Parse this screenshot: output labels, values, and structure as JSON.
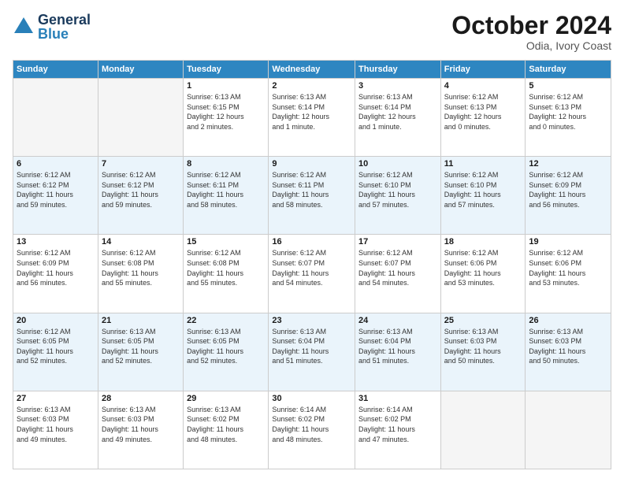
{
  "header": {
    "logo": {
      "line1": "General",
      "line2": "Blue"
    },
    "title": "October 2024",
    "subtitle": "Odia, Ivory Coast"
  },
  "days_of_week": [
    "Sunday",
    "Monday",
    "Tuesday",
    "Wednesday",
    "Thursday",
    "Friday",
    "Saturday"
  ],
  "weeks": [
    [
      {
        "day": "",
        "info": ""
      },
      {
        "day": "",
        "info": ""
      },
      {
        "day": "1",
        "info": "Sunrise: 6:13 AM\nSunset: 6:15 PM\nDaylight: 12 hours\nand 2 minutes."
      },
      {
        "day": "2",
        "info": "Sunrise: 6:13 AM\nSunset: 6:14 PM\nDaylight: 12 hours\nand 1 minute."
      },
      {
        "day": "3",
        "info": "Sunrise: 6:13 AM\nSunset: 6:14 PM\nDaylight: 12 hours\nand 1 minute."
      },
      {
        "day": "4",
        "info": "Sunrise: 6:12 AM\nSunset: 6:13 PM\nDaylight: 12 hours\nand 0 minutes."
      },
      {
        "day": "5",
        "info": "Sunrise: 6:12 AM\nSunset: 6:13 PM\nDaylight: 12 hours\nand 0 minutes."
      }
    ],
    [
      {
        "day": "6",
        "info": "Sunrise: 6:12 AM\nSunset: 6:12 PM\nDaylight: 11 hours\nand 59 minutes."
      },
      {
        "day": "7",
        "info": "Sunrise: 6:12 AM\nSunset: 6:12 PM\nDaylight: 11 hours\nand 59 minutes."
      },
      {
        "day": "8",
        "info": "Sunrise: 6:12 AM\nSunset: 6:11 PM\nDaylight: 11 hours\nand 58 minutes."
      },
      {
        "day": "9",
        "info": "Sunrise: 6:12 AM\nSunset: 6:11 PM\nDaylight: 11 hours\nand 58 minutes."
      },
      {
        "day": "10",
        "info": "Sunrise: 6:12 AM\nSunset: 6:10 PM\nDaylight: 11 hours\nand 57 minutes."
      },
      {
        "day": "11",
        "info": "Sunrise: 6:12 AM\nSunset: 6:10 PM\nDaylight: 11 hours\nand 57 minutes."
      },
      {
        "day": "12",
        "info": "Sunrise: 6:12 AM\nSunset: 6:09 PM\nDaylight: 11 hours\nand 56 minutes."
      }
    ],
    [
      {
        "day": "13",
        "info": "Sunrise: 6:12 AM\nSunset: 6:09 PM\nDaylight: 11 hours\nand 56 minutes."
      },
      {
        "day": "14",
        "info": "Sunrise: 6:12 AM\nSunset: 6:08 PM\nDaylight: 11 hours\nand 55 minutes."
      },
      {
        "day": "15",
        "info": "Sunrise: 6:12 AM\nSunset: 6:08 PM\nDaylight: 11 hours\nand 55 minutes."
      },
      {
        "day": "16",
        "info": "Sunrise: 6:12 AM\nSunset: 6:07 PM\nDaylight: 11 hours\nand 54 minutes."
      },
      {
        "day": "17",
        "info": "Sunrise: 6:12 AM\nSunset: 6:07 PM\nDaylight: 11 hours\nand 54 minutes."
      },
      {
        "day": "18",
        "info": "Sunrise: 6:12 AM\nSunset: 6:06 PM\nDaylight: 11 hours\nand 53 minutes."
      },
      {
        "day": "19",
        "info": "Sunrise: 6:12 AM\nSunset: 6:06 PM\nDaylight: 11 hours\nand 53 minutes."
      }
    ],
    [
      {
        "day": "20",
        "info": "Sunrise: 6:12 AM\nSunset: 6:05 PM\nDaylight: 11 hours\nand 52 minutes."
      },
      {
        "day": "21",
        "info": "Sunrise: 6:13 AM\nSunset: 6:05 PM\nDaylight: 11 hours\nand 52 minutes."
      },
      {
        "day": "22",
        "info": "Sunrise: 6:13 AM\nSunset: 6:05 PM\nDaylight: 11 hours\nand 52 minutes."
      },
      {
        "day": "23",
        "info": "Sunrise: 6:13 AM\nSunset: 6:04 PM\nDaylight: 11 hours\nand 51 minutes."
      },
      {
        "day": "24",
        "info": "Sunrise: 6:13 AM\nSunset: 6:04 PM\nDaylight: 11 hours\nand 51 minutes."
      },
      {
        "day": "25",
        "info": "Sunrise: 6:13 AM\nSunset: 6:03 PM\nDaylight: 11 hours\nand 50 minutes."
      },
      {
        "day": "26",
        "info": "Sunrise: 6:13 AM\nSunset: 6:03 PM\nDaylight: 11 hours\nand 50 minutes."
      }
    ],
    [
      {
        "day": "27",
        "info": "Sunrise: 6:13 AM\nSunset: 6:03 PM\nDaylight: 11 hours\nand 49 minutes."
      },
      {
        "day": "28",
        "info": "Sunrise: 6:13 AM\nSunset: 6:03 PM\nDaylight: 11 hours\nand 49 minutes."
      },
      {
        "day": "29",
        "info": "Sunrise: 6:13 AM\nSunset: 6:02 PM\nDaylight: 11 hours\nand 48 minutes."
      },
      {
        "day": "30",
        "info": "Sunrise: 6:14 AM\nSunset: 6:02 PM\nDaylight: 11 hours\nand 48 minutes."
      },
      {
        "day": "31",
        "info": "Sunrise: 6:14 AM\nSunset: 6:02 PM\nDaylight: 11 hours\nand 47 minutes."
      },
      {
        "day": "",
        "info": ""
      },
      {
        "day": "",
        "info": ""
      }
    ]
  ]
}
